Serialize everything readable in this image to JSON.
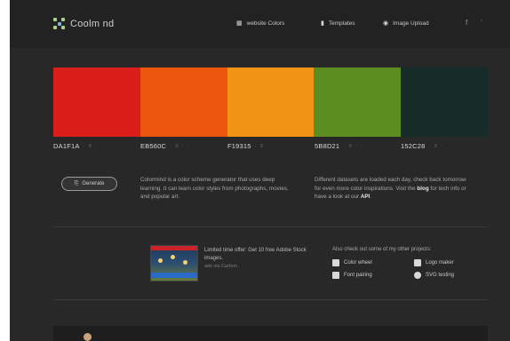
{
  "app": {
    "name": "Coolm nd"
  },
  "nav": {
    "items": [
      {
        "label": "website Colors",
        "icon": "grid-icon"
      },
      {
        "label": "Templates",
        "icon": "bookmark-icon"
      },
      {
        "label": "Image Upload",
        "icon": "camera-icon"
      }
    ],
    "social": [
      "f",
      "’"
    ]
  },
  "palette": {
    "colors": [
      {
        "hex_label": "DA1F1A",
        "color": "#da1f1a"
      },
      {
        "hex_label": "EB560C",
        "color": "#eb560c"
      },
      {
        "hex_label": "F19315",
        "color": "#f19315"
      },
      {
        "hex_label": "5B8D21",
        "color": "#5b8d21"
      },
      {
        "hex_label": "152C28",
        "color": "#152c28"
      }
    ],
    "tool_glyphs": [
      "·",
      "≡",
      "·",
      "·"
    ]
  },
  "generate": {
    "label": "Generate",
    "icon": "refresh-icon"
  },
  "about": {
    "left_text": "Colormind is a color scheme generator that uses deep learning. It can learn color styles from photographs, movies, and popular art.",
    "right_text_1": "Different datasets are loaded each day, check back tomorrow for even more color inspirations. Visit the ",
    "right_link": "blog",
    "right_text_2": " for tech info or have a look at our ",
    "right_link_2": "API",
    "right_text_3": "."
  },
  "ad": {
    "title": "Limited time offer: Get 10 free Adobe Stock images.",
    "sub": "ads via Carbon"
  },
  "projects": {
    "heading": "Also check out some of my other projects:",
    "items": [
      {
        "label": "Color wheel",
        "icon": "color-wheel-icon"
      },
      {
        "label": "Logo maker",
        "icon": "logo-maker-icon"
      },
      {
        "label": "Font pairing",
        "icon": "font-pairing-icon"
      },
      {
        "label": "SVG testing",
        "icon": "svg-testing-icon"
      }
    ]
  }
}
